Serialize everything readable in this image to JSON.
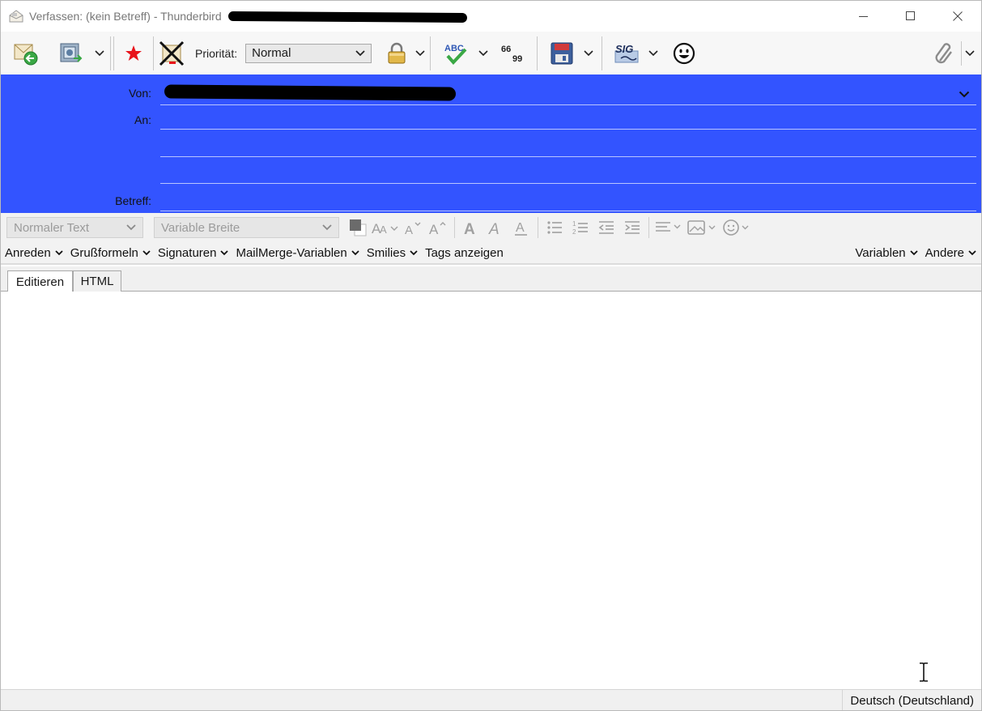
{
  "window": {
    "title": "Verfassen: (kein Betreff) - Thunderbird"
  },
  "toolbar": {
    "priority_label": "Priorität:",
    "priority_value": "Normal"
  },
  "header": {
    "from_label": "Von:",
    "to_label": "An:",
    "subject_label": "Betreff:"
  },
  "format": {
    "paragraph_format": "Normaler Text",
    "font_family": "Variable Breite"
  },
  "menus": {
    "left": [
      "Anreden",
      "Grußformeln",
      "Signaturen",
      "MailMerge-Variablen",
      "Smilies"
    ],
    "tags_label": "Tags anzeigen",
    "right": [
      "Variablen",
      "Andere"
    ]
  },
  "tabs": [
    "Editieren",
    "HTML"
  ],
  "status": {
    "language": "Deutsch (Deutschland)"
  },
  "colors": {
    "header_background": "#3354ff",
    "toolbar_background": "#f7f7f7",
    "accent_red": "#e8141b"
  },
  "icons": {
    "send": "send-mail-icon",
    "send_later": "send-later-icon",
    "flag": "red-star-icon",
    "delete": "cancel-x-icon",
    "security": "padlock-icon",
    "spelling": "abc-check-icon",
    "quote": "quote-icon",
    "save": "floppy-disk-icon",
    "signature": "sig-icon",
    "emoji": "smiley-icon",
    "attach": "paperclip-icon"
  }
}
